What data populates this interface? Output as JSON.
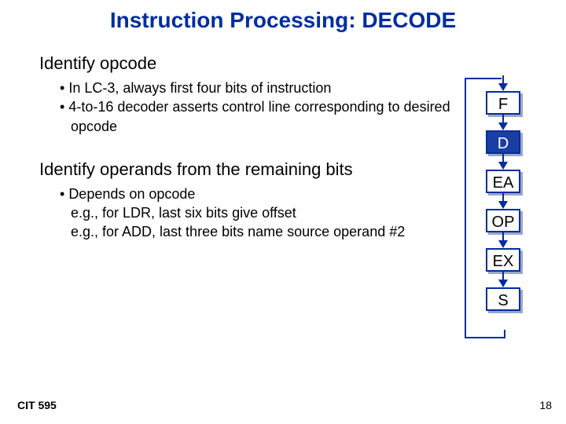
{
  "title": "Instruction Processing: DECODE",
  "section1": {
    "heading": "Identify opcode",
    "b1": "In LC-3, always first four bits of instruction",
    "b2": "4-to-16 decoder asserts control line corresponding to desired opcode"
  },
  "section2": {
    "heading": "Identify operands from the remaining bits",
    "b1": "Depends on opcode",
    "sub1": "e.g., for LDR, last six bits give offset",
    "sub2": "e.g., for ADD, last three bits name source operand #2"
  },
  "stages": {
    "s1": "F",
    "s2": "D",
    "s3": "EA",
    "s4": "OP",
    "s5": "EX",
    "s6": "S"
  },
  "footer": {
    "left": "CIT 595",
    "right": "18"
  }
}
